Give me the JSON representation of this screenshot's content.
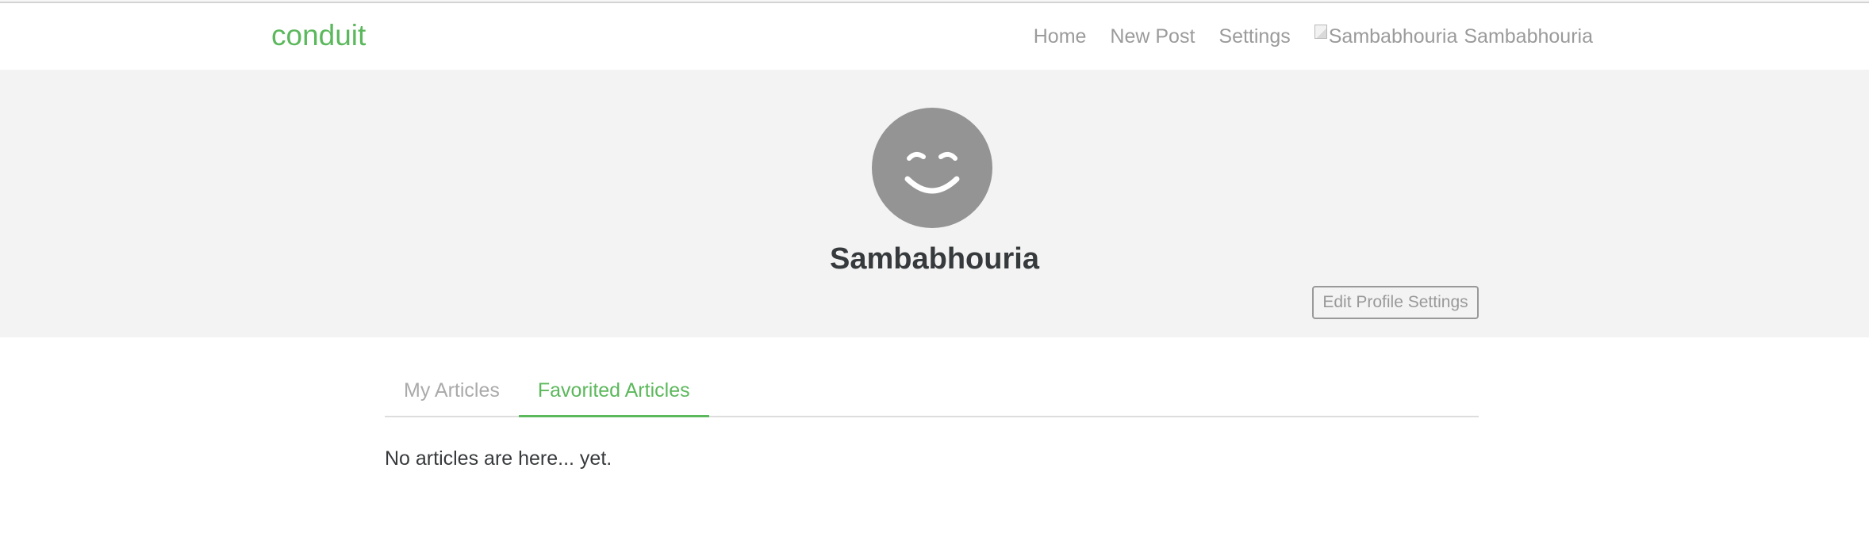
{
  "colors": {
    "brand": "#5cb85c",
    "nav_text": "#9b9b9b",
    "banner_bg": "#f3f3f3",
    "avatar_bg": "#949494",
    "heading": "#373a3c",
    "divider": "#dddddd"
  },
  "navbar": {
    "brand": "conduit",
    "links": {
      "home": "Home",
      "new_post": "New Post",
      "settings": "Settings"
    },
    "user": {
      "avatar_alt": "Sambabhouria",
      "name": "Sambabhouria"
    }
  },
  "profile": {
    "avatar_icon": "smiley-face-icon",
    "username": "Sambabhouria",
    "edit_button": "Edit Profile Settings"
  },
  "tabs": {
    "my_articles": "My Articles",
    "favorited_articles": "Favorited Articles",
    "active": "favorited_articles"
  },
  "feed": {
    "empty_message": "No articles are here... yet."
  }
}
